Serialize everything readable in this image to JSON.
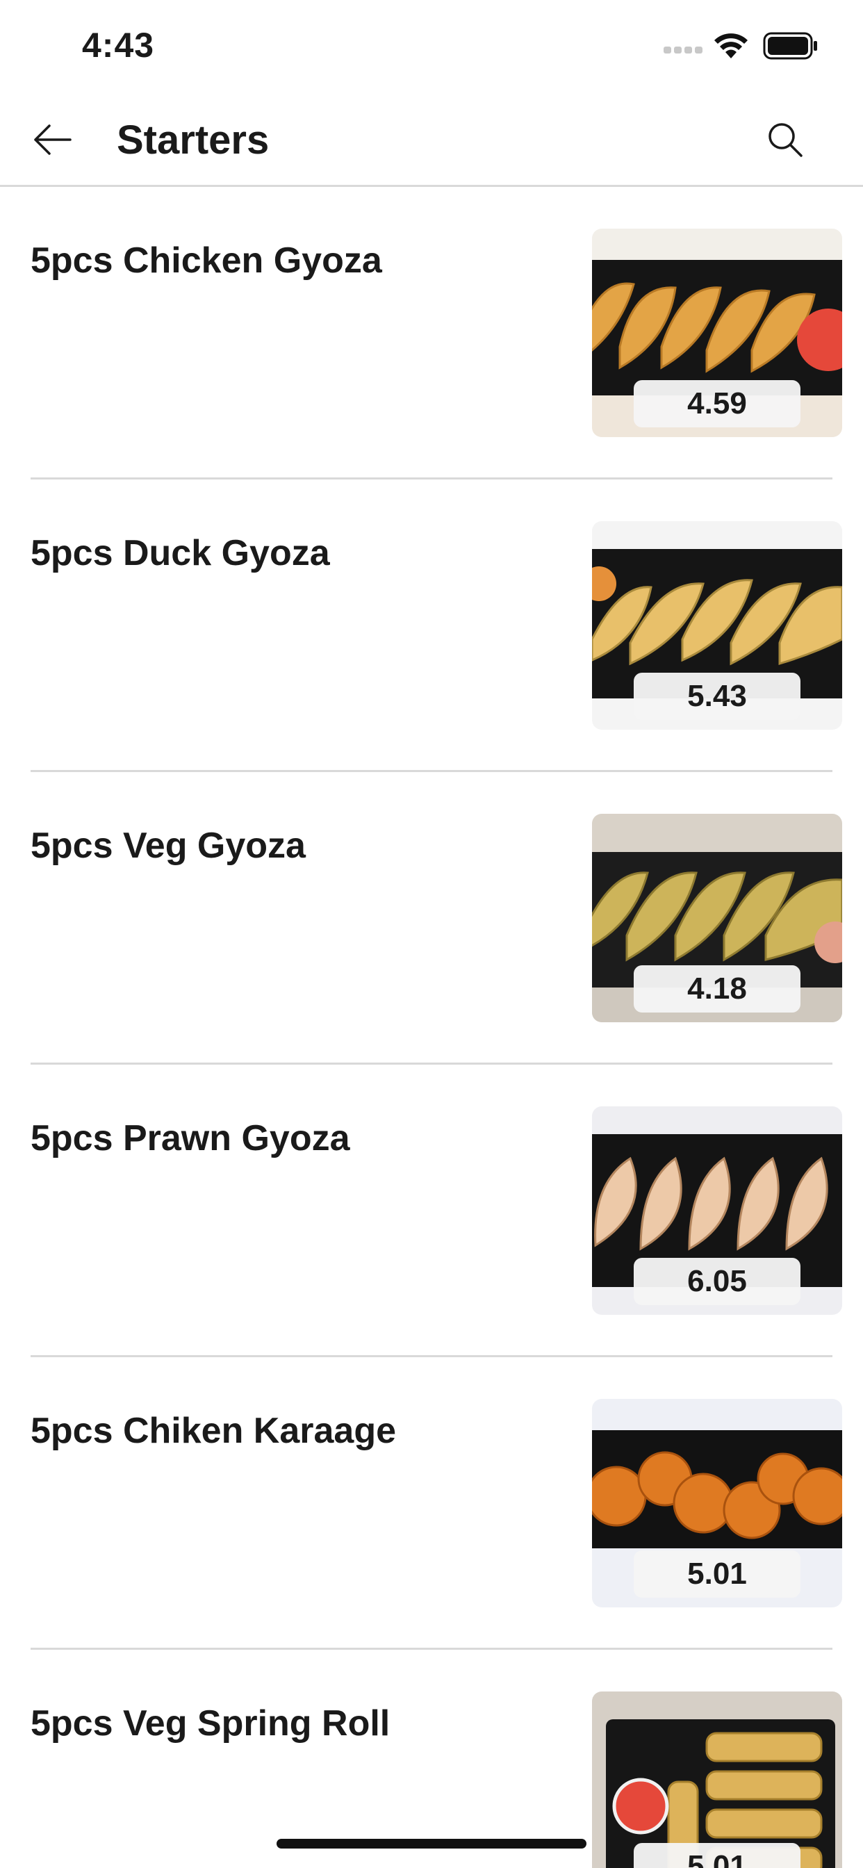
{
  "status_bar": {
    "time": "4:43"
  },
  "header": {
    "title": "Starters"
  },
  "items": [
    {
      "name": "5pcs Chicken Gyoza",
      "price": "4.59",
      "image": "chicken-gyoza-photo"
    },
    {
      "name": "5pcs Duck Gyoza",
      "price": "5.43",
      "image": "duck-gyoza-photo"
    },
    {
      "name": "5pcs Veg Gyoza",
      "price": "4.18",
      "image": "veg-gyoza-photo"
    },
    {
      "name": "5pcs Prawn Gyoza",
      "price": "6.05",
      "image": "prawn-gyoza-photo"
    },
    {
      "name": "5pcs Chiken Karaage",
      "price": "5.01",
      "image": "chicken-karaage-photo"
    },
    {
      "name": "5pcs Veg Spring Roll",
      "price": "5.01",
      "image": "veg-spring-roll-photo"
    }
  ],
  "colors": {
    "divider": "#d9d9d9",
    "text": "#1a1a1a",
    "tray": "#151515",
    "gyoza": "#e0a54a",
    "karaage": "#d9741f",
    "sauce": "#e5483a"
  }
}
